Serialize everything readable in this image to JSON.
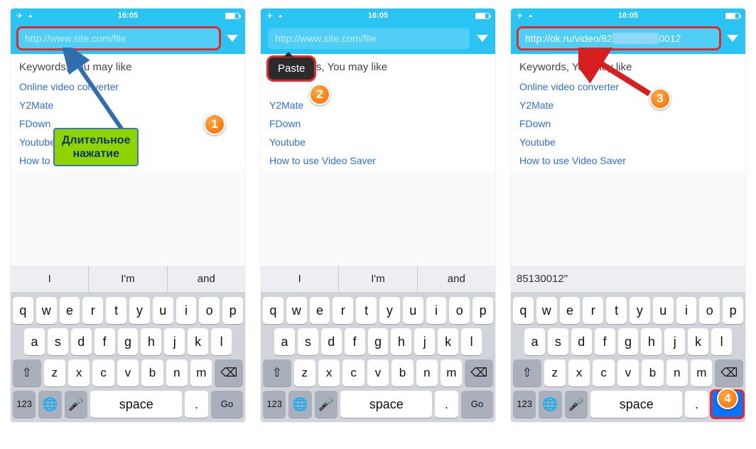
{
  "status": {
    "time": "16:05"
  },
  "url": {
    "placeholder": "http://www.site.com/file",
    "pasted": "http://ok.ru/video/82",
    "pasted_tail": "0012"
  },
  "keywords_header": "Keywords, You may like",
  "keywords_header_cut": "s, You may like",
  "links": {
    "l0": "Online video converter",
    "l1": "Y2Mate",
    "l2": "FDown",
    "l3": "Youtube",
    "l4": "How to use Video Saver"
  },
  "suggestions": {
    "s0": "I",
    "s1": "I'm",
    "s2": "and",
    "alt": "85130012\""
  },
  "kb": {
    "r1": [
      "q",
      "w",
      "e",
      "r",
      "t",
      "y",
      "u",
      "i",
      "o",
      "p"
    ],
    "r2": [
      "a",
      "s",
      "d",
      "f",
      "g",
      "h",
      "j",
      "k",
      "l"
    ],
    "r3": [
      "z",
      "x",
      "c",
      "v",
      "b",
      "n",
      "m"
    ],
    "num": "123",
    "space": "space",
    "dot": ".",
    "go": "Go"
  },
  "annotations": {
    "long_press": "Длительное\nнажатие",
    "paste": "Paste"
  },
  "badges": {
    "b1": "1",
    "b2": "2",
    "b3": "3",
    "b4": "4"
  }
}
